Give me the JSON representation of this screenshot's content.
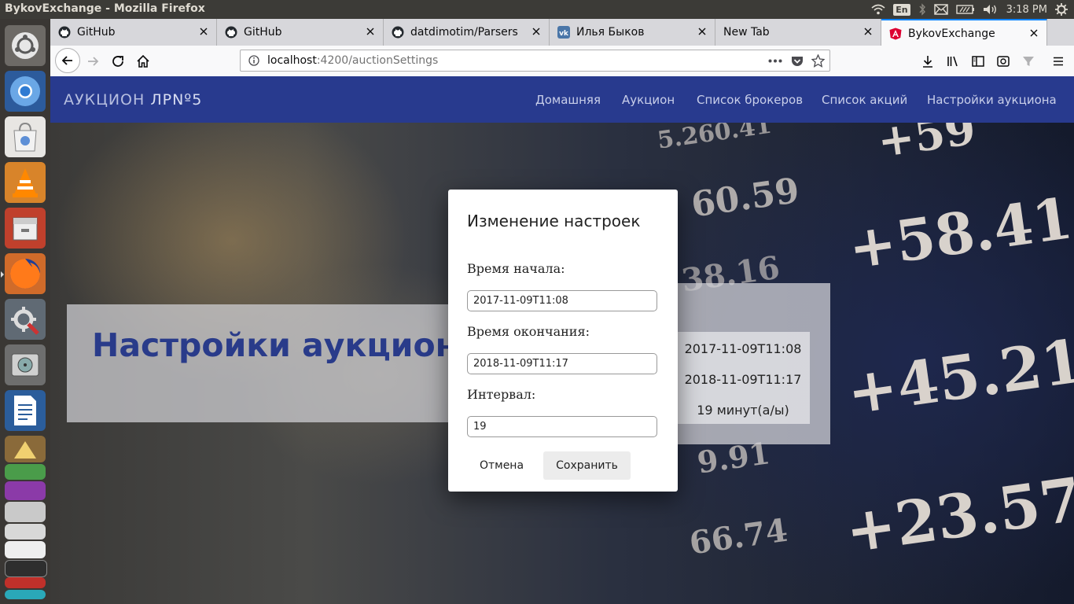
{
  "system_bar": {
    "window_title": "BykovExchange - Mozilla Firefox",
    "keyboard_layout": "En",
    "clock": "3:18 PM"
  },
  "launcher": {
    "apps": [
      "ubuntu-dash-icon",
      "chromium-icon",
      "software-center-icon",
      "vlc-icon",
      "files-icon",
      "firefox-icon",
      "settings-icon",
      "disk-utility-icon",
      "writer-icon",
      "bleachbit-icon",
      "workspaces-icon",
      "app-stack-icon",
      "app-stack-icon",
      "terminal-icon",
      "app-stack-icon"
    ]
  },
  "browser": {
    "tabs": [
      {
        "label": "GitHub",
        "icon": "github-icon"
      },
      {
        "label": "GitHub",
        "icon": "github-icon"
      },
      {
        "label": "datdimotim/Parsers",
        "icon": "github-icon"
      },
      {
        "label": "Илья Быков",
        "icon": "vk-icon"
      },
      {
        "label": "New Tab",
        "icon": "none"
      },
      {
        "label": "BykovExchange",
        "icon": "angular-icon",
        "active": true
      }
    ],
    "url": {
      "host": "localhost",
      "path": ":4200/auctionSettings"
    }
  },
  "app": {
    "brand_prefix": "АУКЦИОН",
    "brand_suffix": "ЛРNº5",
    "nav": [
      "Домашняя",
      "Аукцион",
      "Список брокеров",
      "Список акций",
      "Настройки аукциона"
    ],
    "hero_title": "Настройки аукцион",
    "info": {
      "start": "2017-11-09T11:08",
      "end": "2018-11-09T11:17",
      "interval": "19 минут(а/ы)"
    },
    "background_tickers": [
      "+59",
      "5.260.41",
      "60.59",
      "+58.41",
      "38.16",
      "+45.21",
      "9.91",
      "+23.57",
      "66.74"
    ]
  },
  "modal": {
    "title": "Изменение настроек",
    "start_label": "Время начала:",
    "start_value": "2017-11-09T11:08",
    "end_label": "Время окончания:",
    "end_value": "2018-11-09T11:17",
    "interval_label": "Интервал:",
    "interval_value": "19",
    "cancel_label": "Отмена",
    "save_label": "Сохранить"
  },
  "colors": {
    "app_nav": "#283a8e",
    "hero_title": "#293b8a",
    "tab_accent": "#0a84ff"
  }
}
